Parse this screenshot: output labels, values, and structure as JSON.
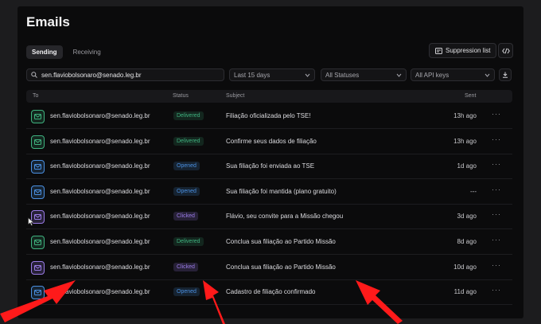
{
  "page": {
    "title": "Emails"
  },
  "tabs": [
    {
      "label": "Sending",
      "active": true
    },
    {
      "label": "Receiving",
      "active": false
    }
  ],
  "toolbar": {
    "suppression_label": "Suppression list",
    "code_icon": "code-icon"
  },
  "filters": {
    "search_value": "sen.flaviobolsonaro@senado.leg.br",
    "date_range": "Last 15 days",
    "statuses": "All Statuses",
    "api_keys": "All API keys"
  },
  "table": {
    "headers": {
      "to": "To",
      "status": "Status",
      "subject": "Subject",
      "sent": "Sent"
    },
    "rows": [
      {
        "to": "sen.flaviobolsonaro@senado.leg.br",
        "status": "Delivered",
        "subject": "Filiação oficializada pelo TSE!",
        "sent": "13h ago",
        "more": "···"
      },
      {
        "to": "sen.flaviobolsonaro@senado.leg.br",
        "status": "Delivered",
        "subject": "Confirme seus dados de filiação",
        "sent": "13h ago",
        "more": "···"
      },
      {
        "to": "sen.flaviobolsonaro@senado.leg.br",
        "status": "Opened",
        "subject": "Sua filiação foi enviada ao TSE",
        "sent": "1d ago",
        "more": "···"
      },
      {
        "to": "sen.flaviobolsonaro@senado.leg.br",
        "status": "Opened",
        "subject": "Sua filiação foi mantida (plano gratuito)",
        "sent": "---",
        "more": "···"
      },
      {
        "to": "sen.flaviobolsonaro@senado.leg.br",
        "status": "Clicked",
        "subject": "Flávio, seu convite para a Missão chegou",
        "sent": "3d ago",
        "more": "···"
      },
      {
        "to": "sen.flaviobolsonaro@senado.leg.br",
        "status": "Delivered",
        "subject": "Conclua sua filiação ao Partido Missão",
        "sent": "8d ago",
        "more": "···"
      },
      {
        "to": "sen.flaviobolsonaro@senado.leg.br",
        "status": "Clicked",
        "subject": "Conclua sua filiação ao Partido Missão",
        "sent": "10d ago",
        "more": "···"
      },
      {
        "to": "sen.flaviobolsonaro@senado.leg.br",
        "status": "Opened",
        "subject": "Cadastro de filiação confirmado",
        "sent": "11d ago",
        "more": "···"
      }
    ]
  },
  "colors": {
    "delivered": "#3fb27f",
    "opened": "#4a8fe0",
    "clicked": "#9a7be6",
    "annotation_arrow": "#ff1a1a"
  }
}
